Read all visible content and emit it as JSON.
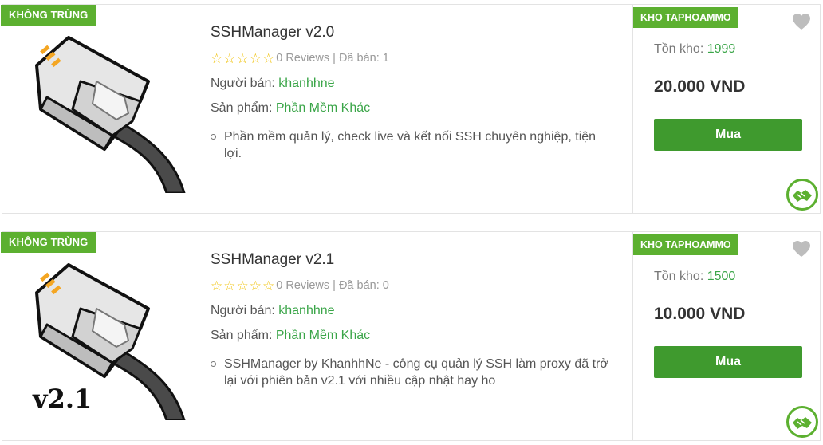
{
  "colors": {
    "accent_green": "#5cb030",
    "button_green": "#3f9a2e",
    "link_green": "#3aa548",
    "star_yellow": "#f0c000"
  },
  "products": [
    {
      "badge": "KHÔNG TRÙNG",
      "title": "SSHManager v2.0",
      "rating_text": "0 Reviews | Đã bán: 1",
      "seller_label": "Người bán:",
      "seller": "khanhhne",
      "category_label": "Sản phẩm:",
      "category": "Phần Mềm Khác",
      "description": "Phần mềm quản lý, check live và kết nối SSH chuyên nghiệp, tiện lợi.",
      "shop_badge": "KHO TAPHOAMMO",
      "stock_label": "Tồn kho:",
      "stock": "1999",
      "price": "20.000 VND",
      "buy_label": "Mua",
      "image_tag": ""
    },
    {
      "badge": "KHÔNG TRÙNG",
      "title": "SSHManager v2.1",
      "rating_text": "0 Reviews | Đã bán: 0",
      "seller_label": "Người bán:",
      "seller": "khanhhne",
      "category_label": "Sản phẩm:",
      "category": "Phần Mềm Khác",
      "description": "SSHManager by KhanhhNe - công cụ quản lý SSH làm proxy đã trở lại với phiên bản v2.1 với nhiều cập nhật hay ho",
      "shop_badge": "KHO TAPHOAMMO",
      "stock_label": "Tồn kho:",
      "stock": "1500",
      "price": "10.000 VND",
      "buy_label": "Mua",
      "image_tag": "v2.1"
    }
  ]
}
